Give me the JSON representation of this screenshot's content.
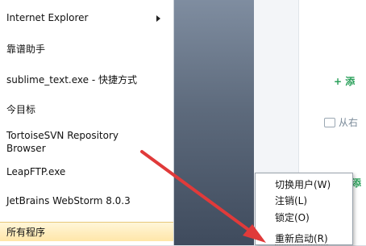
{
  "start_menu": {
    "items": [
      {
        "label": "Internet Explorer",
        "has_submenu": true
      },
      {
        "label": "靠谱助手"
      },
      {
        "label": "sublime_text.exe - 快捷方式"
      },
      {
        "label": "今目标"
      },
      {
        "label": "TortoiseSVN Repository",
        "label2": "Browser"
      },
      {
        "label": "LeapFTP.exe"
      },
      {
        "label": "JetBrains WebStorm 8.0.3"
      }
    ],
    "all_programs": "所有程序"
  },
  "background_app": {
    "add_label": "+ 添",
    "from_label": "从右",
    "add2_label": "添"
  },
  "power_menu": {
    "items": [
      "切换用户(W)",
      "注销(L)",
      "锁定(O)",
      "重新启动(R)"
    ]
  },
  "annotation": {
    "color": "#e03a3a"
  }
}
